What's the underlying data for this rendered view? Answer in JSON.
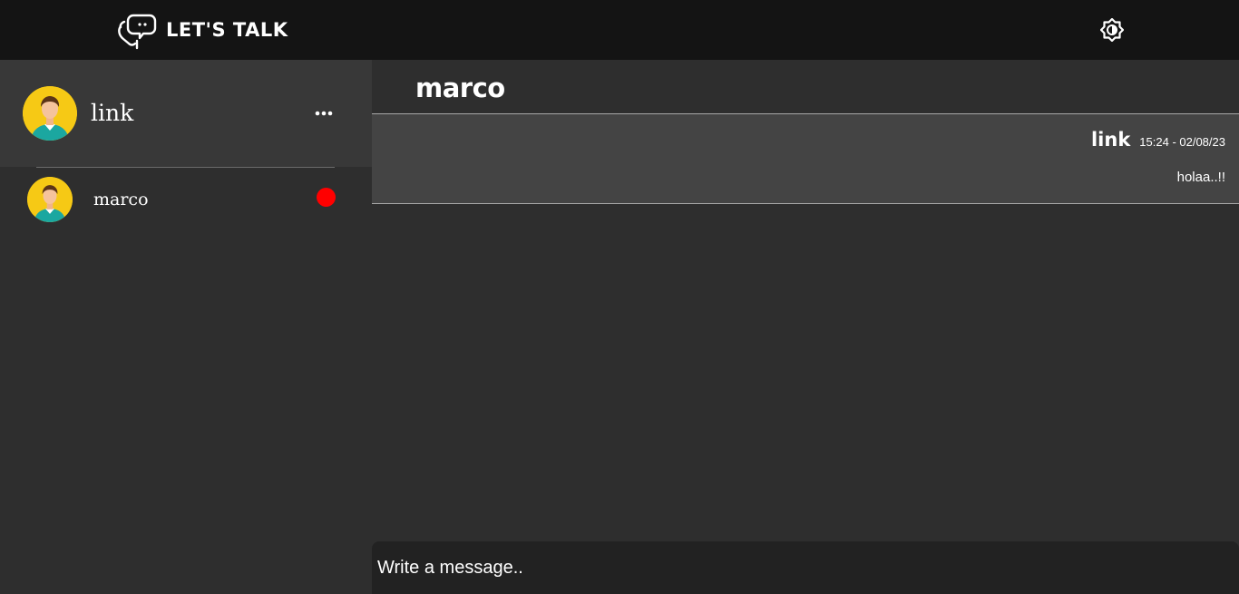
{
  "app": {
    "name": "LET'S TALK"
  },
  "icons": {
    "brand": "chat-hand-logo-icon",
    "theme": "brightness-icon",
    "more": "more-horizontal-icon",
    "avatar": "user-avatar-icon"
  },
  "colors": {
    "topbar": "#141414",
    "background": "#2e2e2e",
    "profile_panel": "#383838",
    "message_bg": "#444444",
    "composer_bg": "#222222",
    "avatar_bg": "#f6c915",
    "offline_status": "#ff0000"
  },
  "sidebar": {
    "current_user": {
      "name": "link"
    },
    "contacts": [
      {
        "name": "marco",
        "status": "offline"
      }
    ]
  },
  "chat": {
    "title": "marco",
    "messages": [
      {
        "author": "link",
        "time": "15:24 - 02/08/23",
        "text": "holaa..!!"
      }
    ]
  },
  "composer": {
    "placeholder": "Write a message.."
  }
}
